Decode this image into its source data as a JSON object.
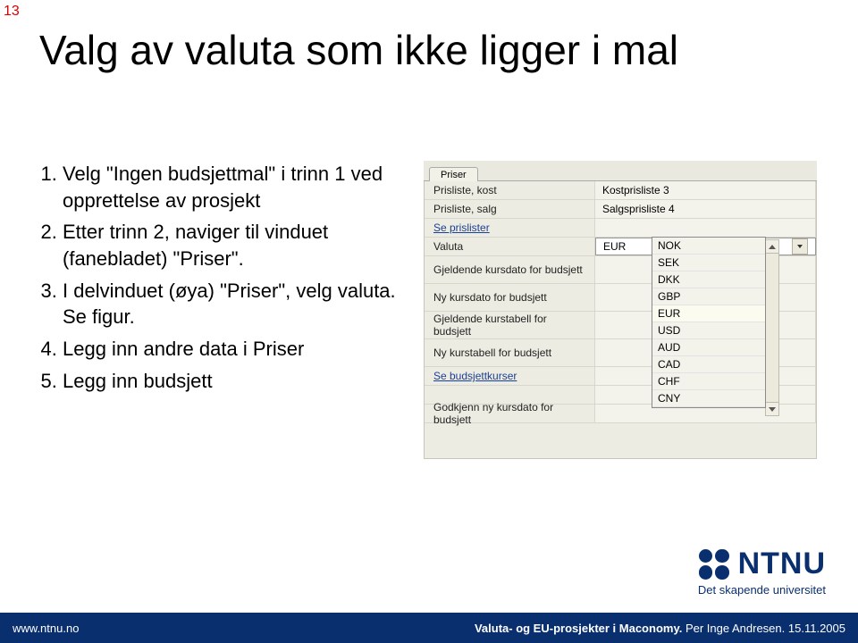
{
  "page_number": "13",
  "title": "Valg av valuta som ikke ligger i mal",
  "bullets": [
    "Velg \"Ingen budsjettmal\" i trinn 1 ved opprettelse av prosjekt",
    "Etter trinn 2, naviger til vinduet (fanebladet) \"Priser\".",
    "I delvinduet (øya) \"Priser\", velg valuta. Se figur.",
    "Legg inn andre data i Priser",
    "Legg inn budsjett"
  ],
  "app": {
    "tab": "Priser",
    "rows": [
      {
        "label": "Prisliste, kost",
        "value": "Kostprisliste 3",
        "link": false
      },
      {
        "label": "Prisliste, salg",
        "value": "Salgsprisliste 4",
        "link": false
      },
      {
        "label": "Se prislister",
        "value": "",
        "link": true
      },
      {
        "label": "Valuta",
        "value": "EUR",
        "link": false,
        "select": true
      },
      {
        "label": "Gjeldende kursdato for budsjett",
        "value": "",
        "link": false,
        "tall": true
      },
      {
        "label": "Ny kursdato for budsjett",
        "value": "",
        "link": false,
        "tall": true
      },
      {
        "label": "Gjeldende kurstabell for budsjett",
        "value": "",
        "link": false,
        "tall": true
      },
      {
        "label": "Ny kurstabell for budsjett",
        "value": "",
        "link": false,
        "tall": true
      },
      {
        "label": "Se budsjettkurser",
        "value": "",
        "link": true
      },
      {
        "label": "",
        "value": "",
        "link": false
      },
      {
        "label": "Godkjenn ny kursdato for budsjett",
        "value": "",
        "link": false
      }
    ],
    "dropdown_options": [
      "NOK",
      "SEK",
      "DKK",
      "GBP",
      "EUR",
      "USD",
      "AUD",
      "CAD",
      "CHF",
      "CNY"
    ],
    "dropdown_highlight": "EUR"
  },
  "logo": {
    "name": "NTNU",
    "tagline": "Det skapende universitet"
  },
  "footer": {
    "url": "www.ntnu.no",
    "presentation": "Valuta- og EU-prosjekter i Maconomy.",
    "author": "Per Inge Andresen.",
    "date": "15.11.2005"
  }
}
